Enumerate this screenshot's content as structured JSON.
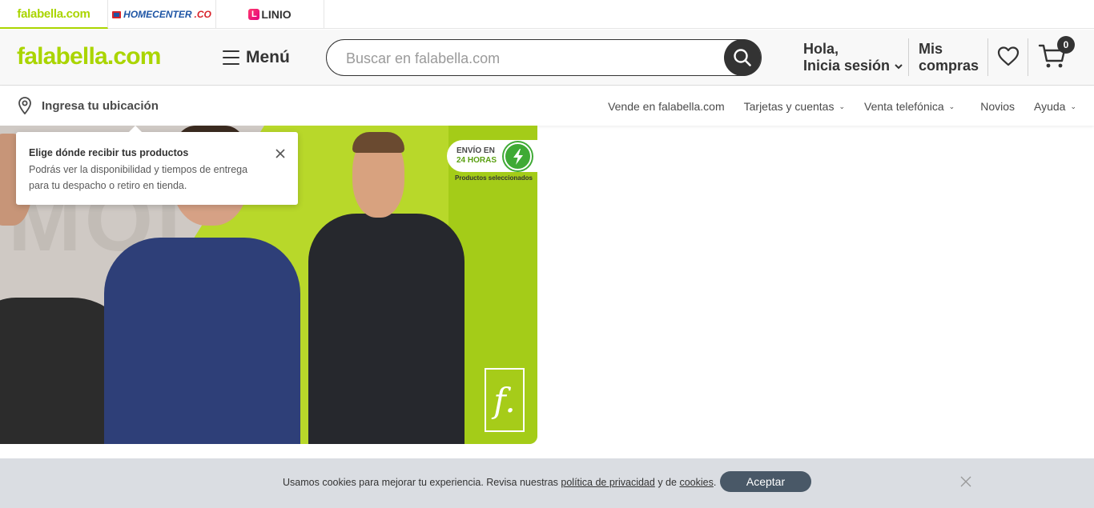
{
  "brands": {
    "falabella": "falabella.com",
    "homecenter": "HOMECENTER",
    "homecenter_suffix": ".CO",
    "linio": "LINIO"
  },
  "header": {
    "logo": "falabella.com",
    "menu_label": "Menú",
    "search_placeholder": "Buscar en falabella.com",
    "hola_line1": "Hola,",
    "hola_line2": "Inicia sesión",
    "mis_line1": "Mis",
    "mis_line2": "compras",
    "cart_count": "0"
  },
  "subnav": {
    "location_label": "Ingresa tu ubicación",
    "links": [
      "Vende en falabella.com",
      "Tarjetas y cuentas",
      "Venta telefónica",
      "Novios",
      "Ayuda"
    ]
  },
  "banner": {
    "bg_text": "MODA",
    "envio_line1": "ENVÍO EN",
    "envio_line2": "24 HORAS",
    "envio_sub": "Productos seleccionados",
    "f_logo": "f."
  },
  "tooltip": {
    "title": "Elige dónde recibir tus productos",
    "body": "Podrás ver la disponibilidad y tiempos de entrega para tu despacho o retiro en tienda."
  },
  "cookies": {
    "text_before": "Usamos cookies para mejorar tu experiencia. Revisa nuestras",
    "privacy_link": "política de privacidad",
    "text_mid": "y de",
    "cookies_link": "cookies",
    "text_end": ".",
    "accept_label": "Aceptar"
  },
  "colors": {
    "brand_green": "#aad500",
    "dark": "#333333",
    "cookie_bg": "#dadde2",
    "accept_bg": "#495867"
  },
  "icons": [
    "search-icon",
    "heart-icon",
    "cart-icon",
    "location-pin-icon",
    "close-icon",
    "chevron-down-icon",
    "lightning-icon",
    "hamburger-icon"
  ]
}
